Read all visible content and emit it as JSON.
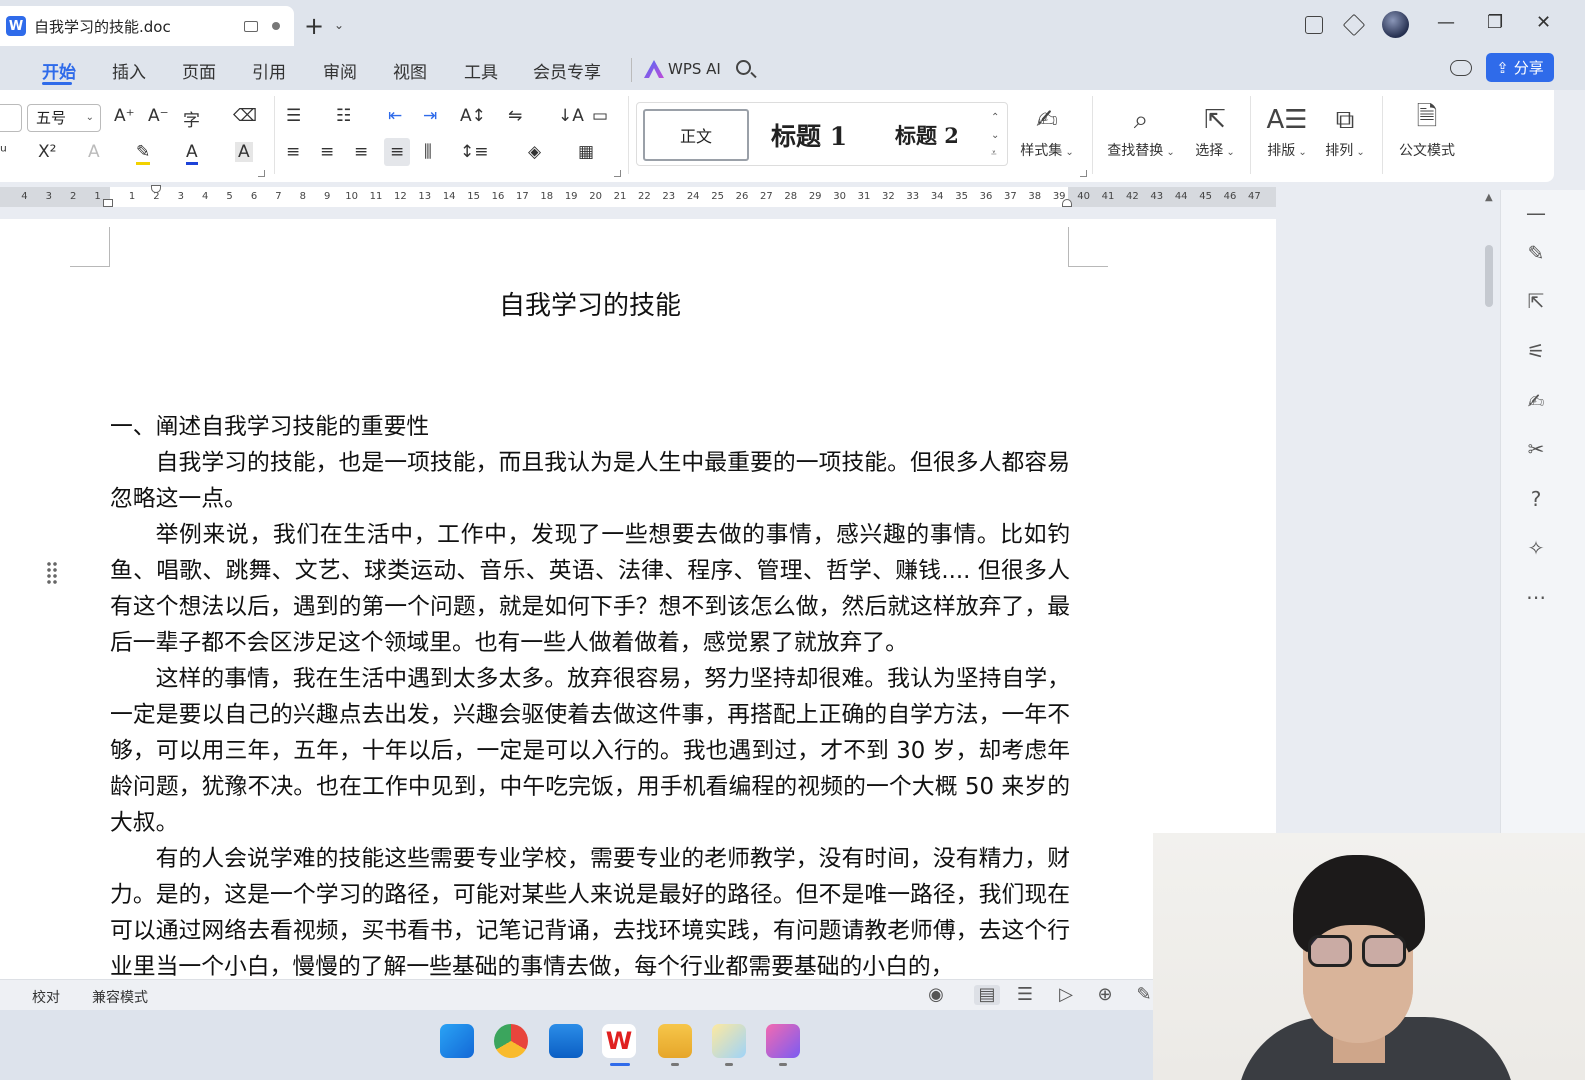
{
  "titlebar": {
    "doc_tab_title": "自我学习的技能.doc",
    "app_badge": "W"
  },
  "menu": {
    "tabs": [
      "开始",
      "插入",
      "页面",
      "引用",
      "审阅",
      "视图",
      "工具",
      "会员专享"
    ],
    "active_tab": "开始",
    "wps_ai": "WPS AI",
    "share": "分享"
  },
  "ribbon": {
    "font_size": "五号",
    "styles": {
      "normal": "正文",
      "h1": "标题 1",
      "h2": "标题 2"
    },
    "style_set": "样式集",
    "find_replace": "查找替换",
    "select": "选择",
    "layout": "排版",
    "arrange": "排列",
    "official_mode": "公文模式"
  },
  "ruler": {
    "left_numbers": [
      "4",
      "3",
      "2",
      "1"
    ],
    "right_numbers": [
      "1",
      "2",
      "3",
      "4",
      "5",
      "6",
      "7",
      "8",
      "9",
      "10",
      "11",
      "12",
      "13",
      "14",
      "15",
      "16",
      "17",
      "18",
      "19",
      "20",
      "21",
      "22",
      "23",
      "24",
      "25",
      "26",
      "27",
      "28",
      "29",
      "30",
      "31",
      "32",
      "33",
      "34",
      "35",
      "36",
      "37",
      "38",
      "39",
      "40",
      "41",
      "42",
      "43",
      "44",
      "45",
      "46",
      "47"
    ]
  },
  "document": {
    "title": "自我学习的技能",
    "heading": "一、阐述自我学习技能的重要性",
    "paragraphs": [
      "自我学习的技能，也是一项技能，而且我认为是人生中最重要的一项技能。但很多人都容易忽略这一点。",
      "举例来说，我们在生活中，工作中，发现了一些想要去做的事情，感兴趣的事情。比如钓鱼、唱歌、跳舞、文艺、球类运动、音乐、英语、法律、程序、管理、哲学、赚钱.... 但很多人有这个想法以后，遇到的第一个问题，就是如何下手？想不到该怎么做，然后就这样放弃了，最后一辈子都不会区涉足这个领域里。也有一些人做着做着，感觉累了就放弃了。",
      "这样的事情，我在生活中遇到太多太多。放弃很容易，努力坚持却很难。我认为坚持自学，一定是要以自己的兴趣点去出发，兴趣会驱使着去做这件事，再搭配上正确的自学方法，一年不够，可以用三年，五年，十年以后，一定是可以入行的。我也遇到过，才不到 30 岁，却考虑年龄问题，犹豫不决。也在工作中见到，中午吃完饭，用手机看编程的视频的一个大概 50 来岁的大叔。",
      "有的人会说学难的技能这些需要专业学校，需要专业的老师教学，没有时间，没有精力，财力。是的，这是一个学习的路径，可能对某些人来说是最好的路径。但不是唯一路径，我们现在可以通过网络去看视频，买书看书，记笔记背诵，去找环境实践，有问题请教老师傅，去这个行业里当一个小白，慢慢的了解一些基础的事情去做，每个行业都需要基础的小白的，"
    ]
  },
  "statusbar": {
    "proofread": "校对",
    "compat_mode": "兼容模式"
  },
  "colors": {
    "accent": "#2f6bea",
    "chrome": "#dfe4ec",
    "page": "#ffffff"
  }
}
